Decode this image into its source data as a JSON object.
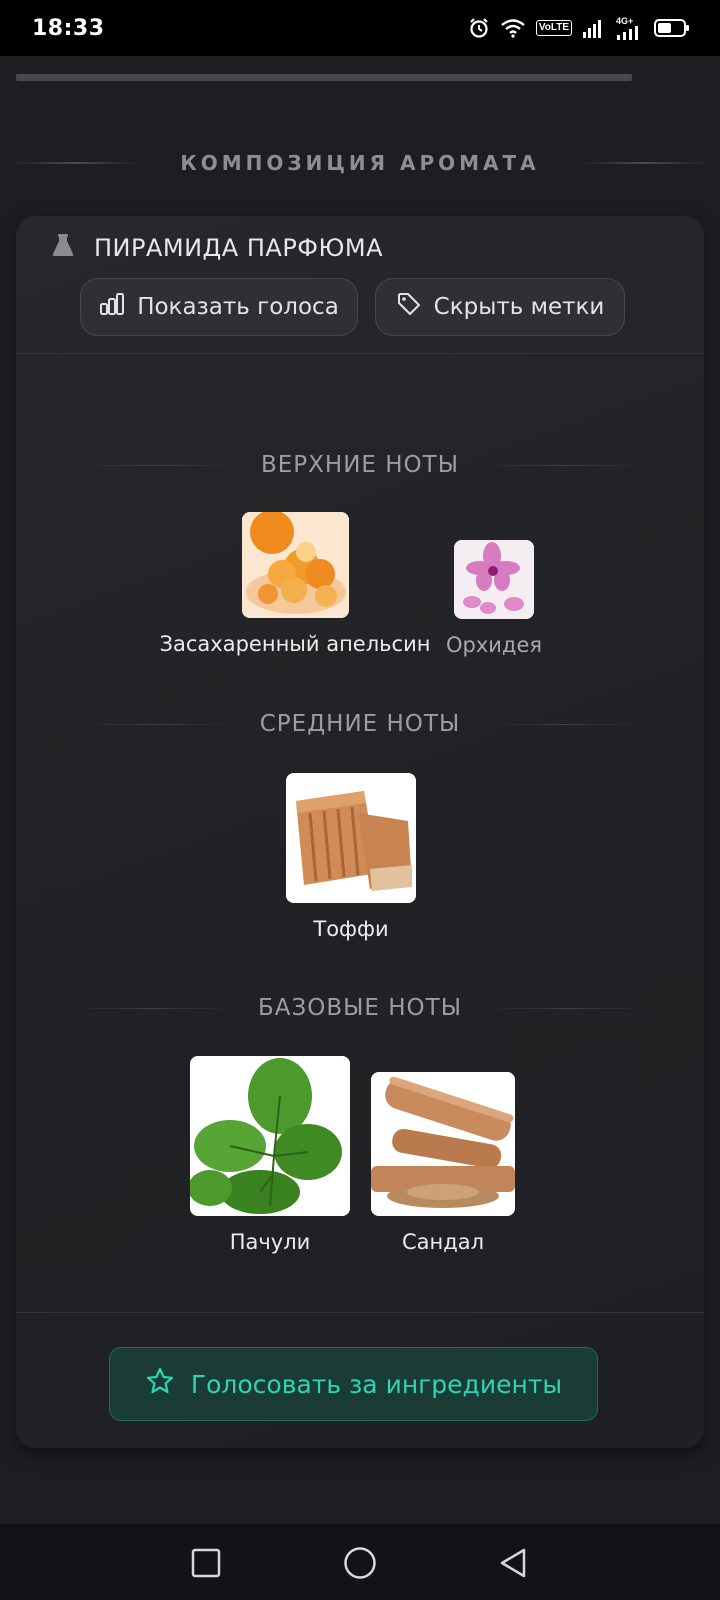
{
  "status_bar": {
    "time": "18:33",
    "volte": "VoLTE",
    "network": "4G+",
    "icons": [
      "alarm-icon",
      "wifi-icon",
      "volte-icon",
      "signal-icon",
      "signal-4g-icon",
      "battery-icon"
    ]
  },
  "section": {
    "title": "КОМПОЗИЦИЯ АРОМАТА"
  },
  "pyramid": {
    "title": "ПИРАМИДА ПАРФЮМА",
    "show_votes_label": "Показать голоса",
    "hide_tags_label": "Скрыть метки",
    "tiers": {
      "top": {
        "title": "ВЕРХНИЕ НОТЫ",
        "notes": [
          {
            "name": "Засахаренный апельсин",
            "icon": "candied-orange-image"
          },
          {
            "name": "Орхидея",
            "icon": "orchid-image"
          }
        ]
      },
      "middle": {
        "title": "СРЕДНИЕ НОТЫ",
        "notes": [
          {
            "name": "Тоффи",
            "icon": "toffee-image"
          }
        ]
      },
      "base": {
        "title": "БАЗОВЫЕ НОТЫ",
        "notes": [
          {
            "name": "Пачули",
            "icon": "patchouli-image"
          },
          {
            "name": "Сандал",
            "icon": "sandalwood-image"
          }
        ]
      }
    },
    "vote_button_label": "Голосовать за ингредиенты"
  },
  "colors": {
    "background": "#1d1e21",
    "card": "#242528",
    "accent": "#2dd4b6",
    "muted_text": "#9c9da1"
  },
  "nav_bar": {
    "buttons": [
      "recents-square-icon",
      "home-circle-icon",
      "back-triangle-icon"
    ]
  }
}
